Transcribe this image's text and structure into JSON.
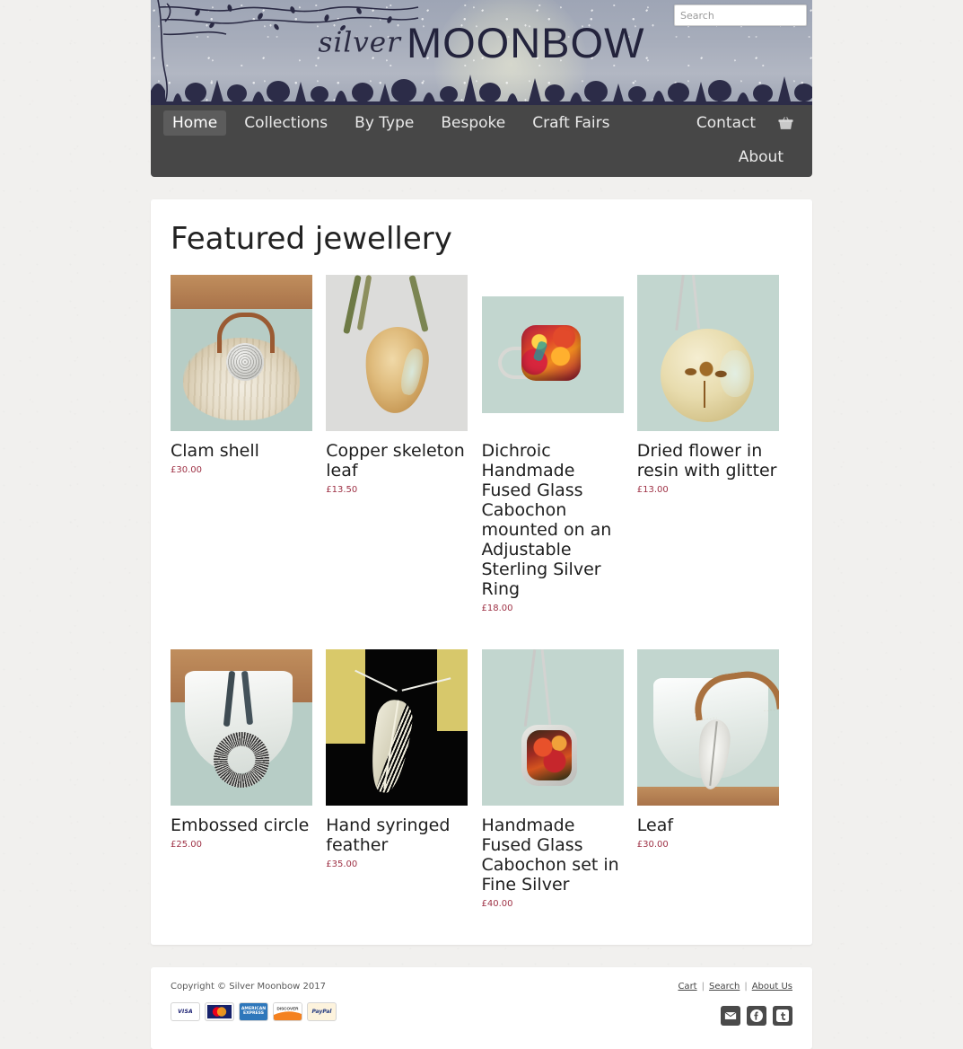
{
  "site": {
    "brand_primary": "silver",
    "brand_secondary": "MOONBOW",
    "nav_bg": "#474747",
    "price_color": "#9e3145"
  },
  "search": {
    "placeholder": "Search",
    "value": "",
    "icon": "search-icon"
  },
  "nav": {
    "primary": [
      {
        "label": "Home",
        "active": true
      },
      {
        "label": "Collections",
        "active": false
      },
      {
        "label": "By Type",
        "active": false
      },
      {
        "label": "Bespoke",
        "active": false
      },
      {
        "label": "Craft Fairs",
        "active": false
      }
    ],
    "right": [
      {
        "label": "Contact"
      }
    ],
    "cart_icon": "shopping-basket-icon",
    "secondary": [
      {
        "label": "About"
      }
    ]
  },
  "main": {
    "heading": "Featured jewellery",
    "products": [
      {
        "name": "Clam shell",
        "price": "£30.00",
        "image": "clam-shell"
      },
      {
        "name": "Copper skeleton leaf",
        "price": "£13.50",
        "image": "copper-skeleton-leaf"
      },
      {
        "name": "Dichroic Handmade Fused Glass Cabochon mounted on an Adjustable Sterling Silver Ring",
        "price": "£18.00",
        "image": "dichroic-ring"
      },
      {
        "name": "Dried flower in resin with glitter",
        "price": "£13.00",
        "image": "dried-flower-resin"
      },
      {
        "name": "Embossed circle",
        "price": "£25.00",
        "image": "embossed-circle"
      },
      {
        "name": "Hand syringed feather",
        "price": "£35.00",
        "image": "hand-syringed-feather"
      },
      {
        "name": "Handmade Fused Glass Cabochon set in Fine Silver",
        "price": "£40.00",
        "image": "fused-glass-cabochon"
      },
      {
        "name": "Leaf",
        "price": "£30.00",
        "image": "leaf-pendant"
      }
    ]
  },
  "footer": {
    "copyright": "Copyright © Silver Moonbow 2017",
    "payment_methods": [
      {
        "name": "VISA",
        "id": "visa"
      },
      {
        "name": "MasterCard",
        "id": "mastercard"
      },
      {
        "name": "AMERICAN EXPRESS",
        "id": "amex"
      },
      {
        "name": "DISCOVER",
        "id": "discover"
      },
      {
        "name": "PayPal",
        "id": "paypal"
      }
    ],
    "links": [
      {
        "label": "Cart"
      },
      {
        "label": "Search"
      },
      {
        "label": "About Us"
      }
    ],
    "separator": "|",
    "social": [
      {
        "name": "email-icon",
        "glyph": "✉"
      },
      {
        "name": "facebook-icon",
        "glyph": "f"
      },
      {
        "name": "twitter-icon",
        "glyph": "t"
      }
    ]
  }
}
